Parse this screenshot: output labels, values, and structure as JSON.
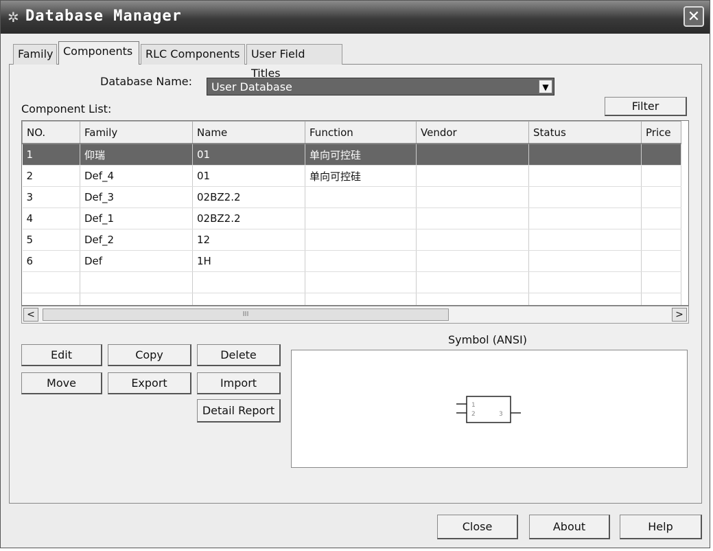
{
  "window": {
    "title": "Database Manager",
    "title_icon": "gear-icon",
    "close_glyph": "✕"
  },
  "tabs": [
    {
      "label": "Family"
    },
    {
      "label": "Components"
    },
    {
      "label": "RLC Components"
    },
    {
      "label": "User Field Titles"
    }
  ],
  "database": {
    "label": "Database Name:",
    "selected": "User Database",
    "arrow": "▼"
  },
  "component_list": {
    "label": "Component List:",
    "filter_label": "Filter"
  },
  "table": {
    "columns": [
      "NO.",
      "Family",
      "Name",
      "Function",
      "Vendor",
      "Status",
      "Price"
    ],
    "rows": [
      [
        "1",
        "仰瑞",
        "01",
        "单向可控硅",
        "",
        "",
        ""
      ],
      [
        "2",
        "Def_4",
        "01",
        "单向可控硅",
        "",
        "",
        ""
      ],
      [
        "3",
        "Def_3",
        "02BZ2.2",
        "",
        "",
        "",
        ""
      ],
      [
        "4",
        "Def_1",
        "02BZ2.2",
        "",
        "",
        "",
        ""
      ],
      [
        "5",
        "Def_2",
        "12",
        "",
        "",
        "",
        ""
      ],
      [
        "6",
        "Def",
        "1H",
        "",
        "",
        "",
        ""
      ],
      [
        "",
        "",
        "",
        "",
        "",
        "",
        ""
      ],
      [
        "",
        "",
        "",
        "",
        "",
        "",
        ""
      ]
    ],
    "selected_row": 0
  },
  "scrollbar": {
    "left_glyph": "<",
    "right_glyph": ">",
    "thumb_grip": "III"
  },
  "actions": {
    "edit": "Edit",
    "copy": "Copy",
    "delete": "Delete",
    "move": "Move",
    "export": "Export",
    "import": "Import",
    "detail_report": "Detail Report"
  },
  "symbol": {
    "label": "Symbol (ANSI)",
    "pins": [
      "1",
      "2",
      "3"
    ]
  },
  "footer": {
    "close": "Close",
    "about": "About",
    "help": "Help"
  }
}
